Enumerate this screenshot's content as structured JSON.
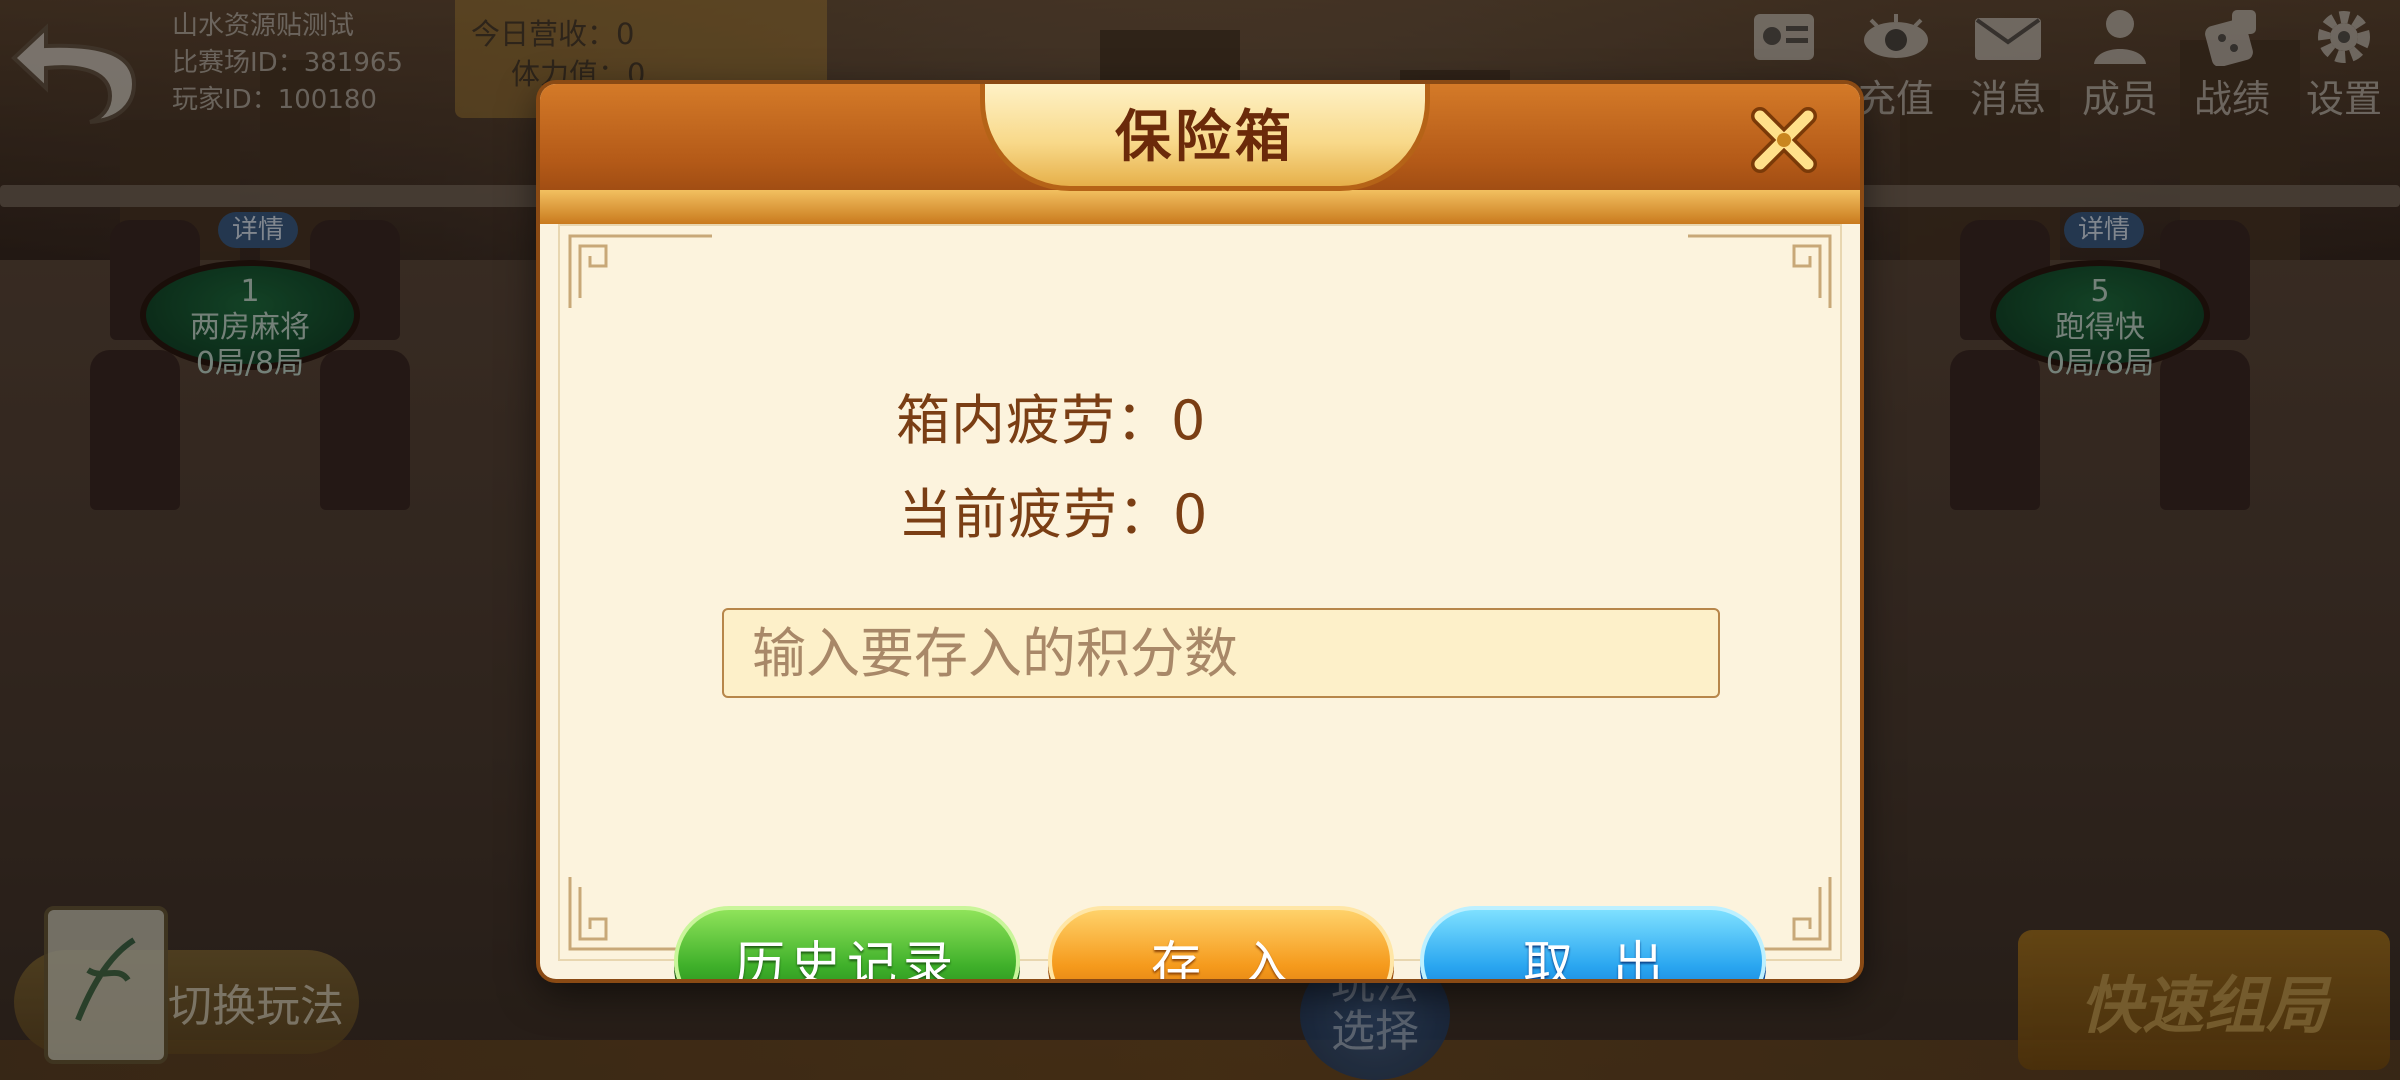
{
  "lobby": {
    "club_name": "山水资源贴测试",
    "match_field_id": "比赛场ID：381965",
    "player_id": "玩家ID：100180",
    "today_revenue": "今日营收：0",
    "stamina": "体力值：0",
    "top_nav": [
      {
        "label": "",
        "icon": "id-card-icon"
      },
      {
        "label": "充值",
        "icon": "eye-icon"
      },
      {
        "label": "消息",
        "icon": "mail-icon"
      },
      {
        "label": "成员",
        "icon": "member-icon"
      },
      {
        "label": "战绩",
        "icon": "dice-icon"
      },
      {
        "label": "设置",
        "icon": "gear-icon"
      }
    ],
    "tables": [
      {
        "number": "1",
        "name": "两房麻将",
        "rounds": "0局/8局",
        "badge": "详情"
      },
      {
        "number": "5",
        "name": "跑得快",
        "rounds": "0局/8局",
        "badge": "详情"
      }
    ],
    "switch_play": "切换玩法",
    "play_select": "玩法选择",
    "quick_match": "快速组局"
  },
  "dialog": {
    "title": "保险箱",
    "box_fatigue_label": "箱内疲劳：0",
    "current_fatigue_label": "当前疲劳：0",
    "input_placeholder": "输入要存入的积分数",
    "input_value": "",
    "buttons": {
      "history": "历史记录",
      "deposit": "存入",
      "withdraw": "取出"
    }
  },
  "colors": {
    "header": "#b45a18",
    "body": "#fcf3dd",
    "label": "#7a3e14",
    "green": "#3fb02a",
    "orange": "#f59a1c",
    "blue": "#2aa6f0"
  }
}
